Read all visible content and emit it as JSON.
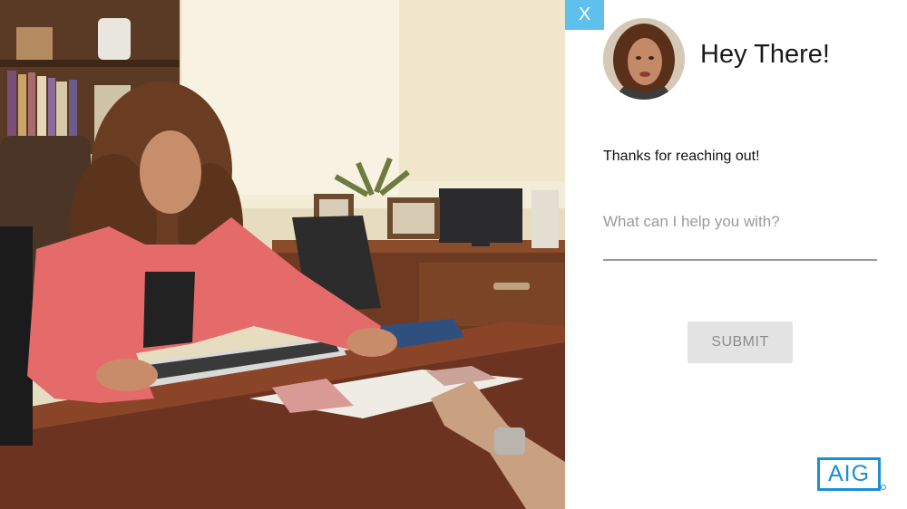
{
  "close_button": {
    "label": "X"
  },
  "chat": {
    "greeting": "Hey There!",
    "message": "Thanks for reaching out!",
    "input": {
      "placeholder": "What can I help you with?",
      "value": ""
    },
    "submit_label": "SUBMIT"
  },
  "brand": {
    "logo_text": "AIG"
  },
  "colors": {
    "close_button": "#5fc0ee",
    "logo": "#1a8fd6",
    "submit_bg": "#e3e3e3",
    "submit_text": "#8d8d8d"
  },
  "icons": [
    "close-icon"
  ]
}
